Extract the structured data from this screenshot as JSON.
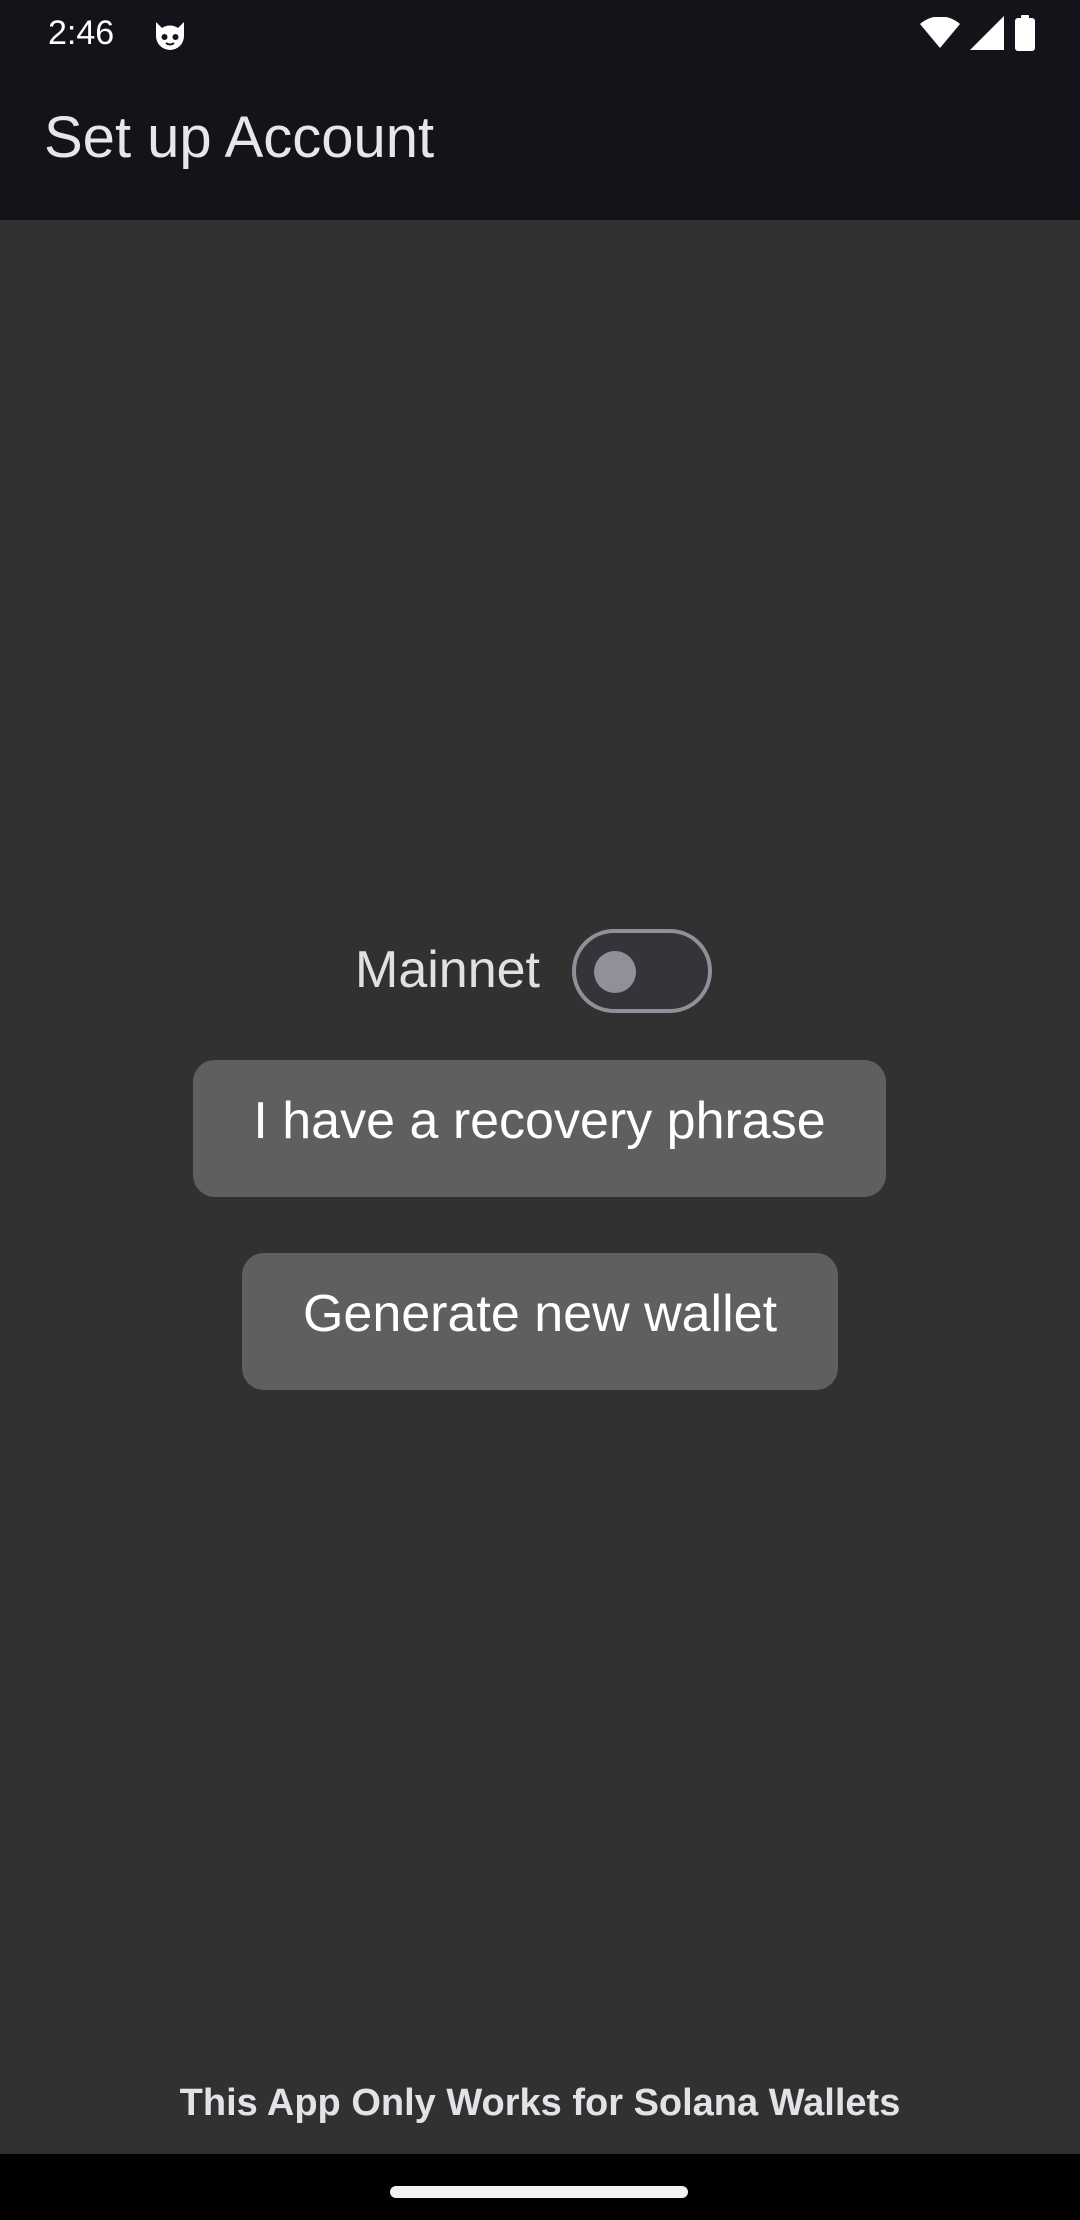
{
  "status_bar": {
    "time": "2:46",
    "app_icon": "cat-face-icon",
    "icons": [
      "wifi-icon",
      "cellular-signal-icon",
      "battery-icon"
    ]
  },
  "app_bar": {
    "title": "Set up Account"
  },
  "network_toggle": {
    "label": "Mainnet",
    "checked": false
  },
  "buttons": {
    "recovery": "I have a recovery phrase",
    "generate": "Generate new wallet"
  },
  "footer": {
    "note": "This App Only Works for Solana Wallets"
  },
  "colors": {
    "background": "#313131",
    "app_bar": "#15131a",
    "button": "#5f5f5f",
    "switch_outline": "#938f99"
  }
}
